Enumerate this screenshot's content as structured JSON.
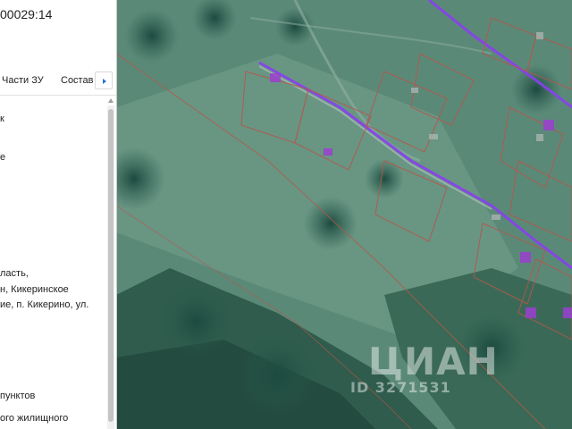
{
  "panel": {
    "cadastral_number": "00029:14",
    "tabs": [
      {
        "label": "Части ЗУ"
      },
      {
        "label": "Состав"
      }
    ],
    "attribute_fragments": [
      "к",
      "е",
      "ласть,",
      "н, Кикеринское",
      "ие, п. Кикерино, ул.",
      "пунктов",
      "",
      "ого жилищного"
    ]
  },
  "map": {
    "layer": "satellite",
    "parcel_outline_color": "#b5574b",
    "building_color": "#9b3fd0",
    "road_color": "#8a3ff0"
  },
  "watermark": {
    "brand": "ЦИАН",
    "id": "ID 3271531"
  }
}
